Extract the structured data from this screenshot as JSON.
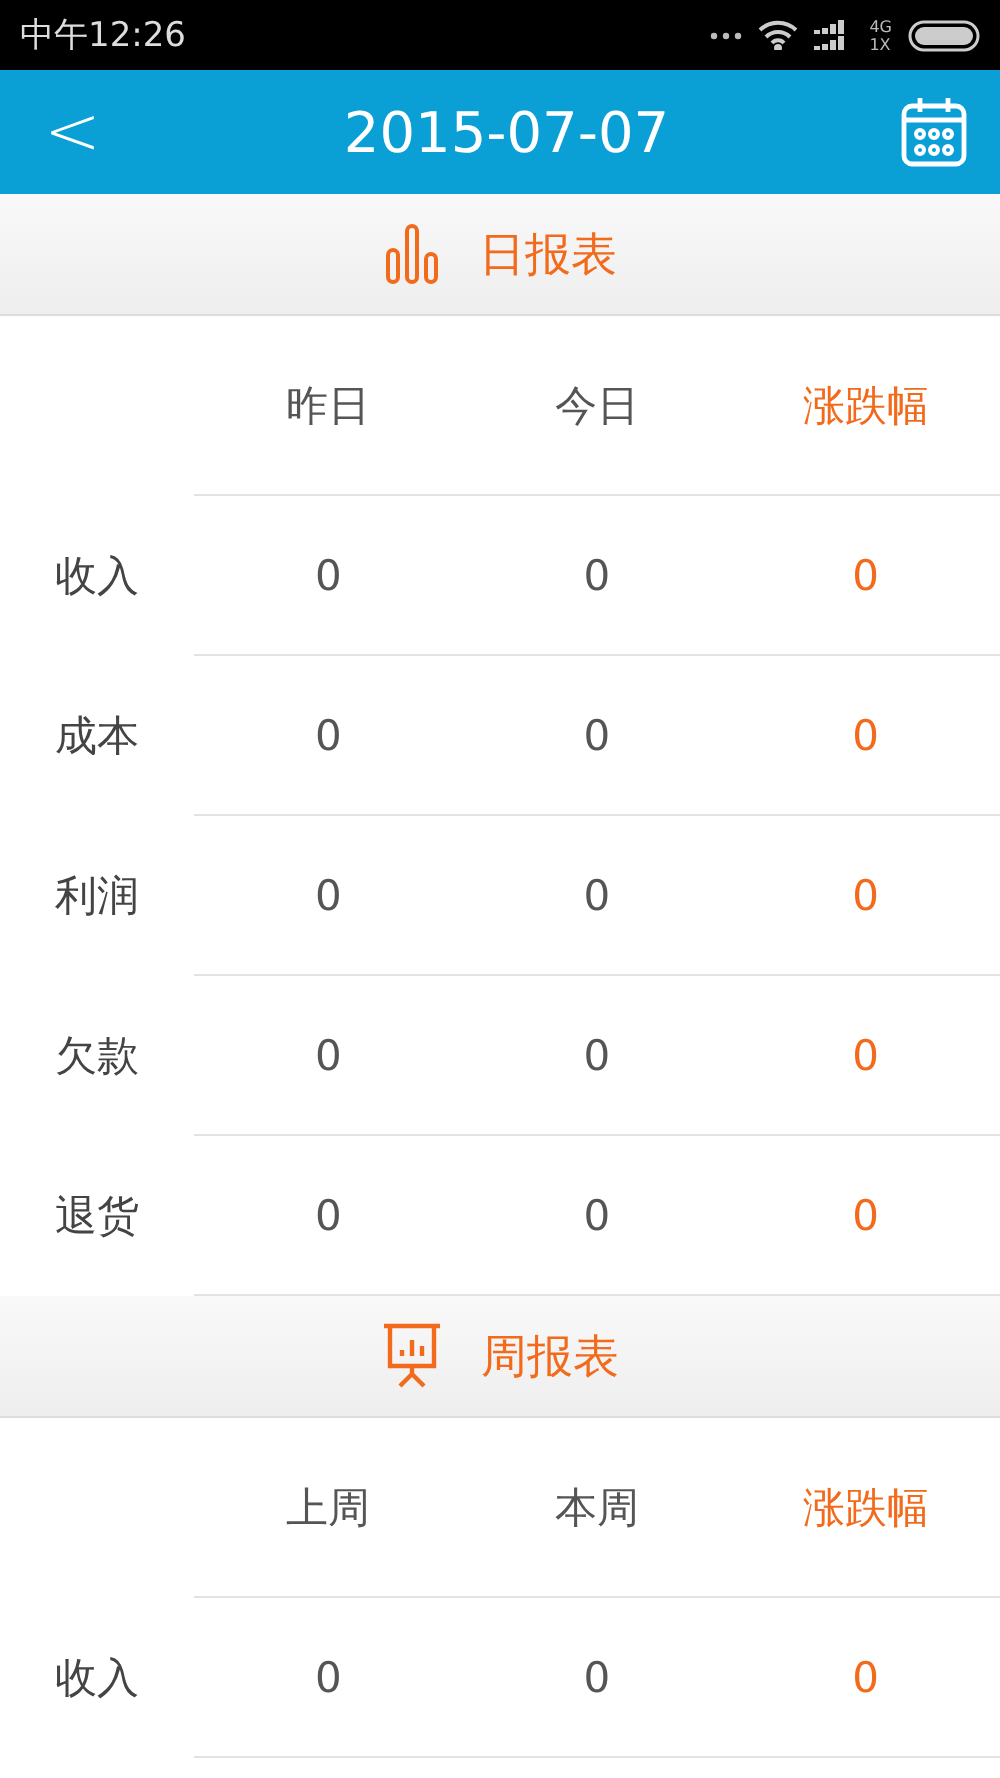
{
  "status_bar": {
    "time": "中午12:26",
    "network_top": "4G",
    "network_bottom": "1X"
  },
  "header": {
    "back": "<",
    "title": "2015-07-07"
  },
  "sections": [
    {
      "kind": "bar-chart",
      "title": "日报表",
      "columns": [
        "昨日",
        "今日",
        "涨跌幅"
      ],
      "rows": [
        {
          "label": "收入",
          "values": [
            "0",
            "0",
            "0"
          ]
        },
        {
          "label": "成本",
          "values": [
            "0",
            "0",
            "0"
          ]
        },
        {
          "label": "利润",
          "values": [
            "0",
            "0",
            "0"
          ]
        },
        {
          "label": "欠款",
          "values": [
            "0",
            "0",
            "0"
          ]
        },
        {
          "label": "退货",
          "values": [
            "0",
            "0",
            "0"
          ]
        }
      ]
    },
    {
      "kind": "presentation",
      "title": "周报表",
      "columns": [
        "上周",
        "本周",
        "涨跌幅"
      ],
      "rows": [
        {
          "label": "收入",
          "values": [
            "0",
            "0",
            "0"
          ]
        }
      ]
    }
  ]
}
